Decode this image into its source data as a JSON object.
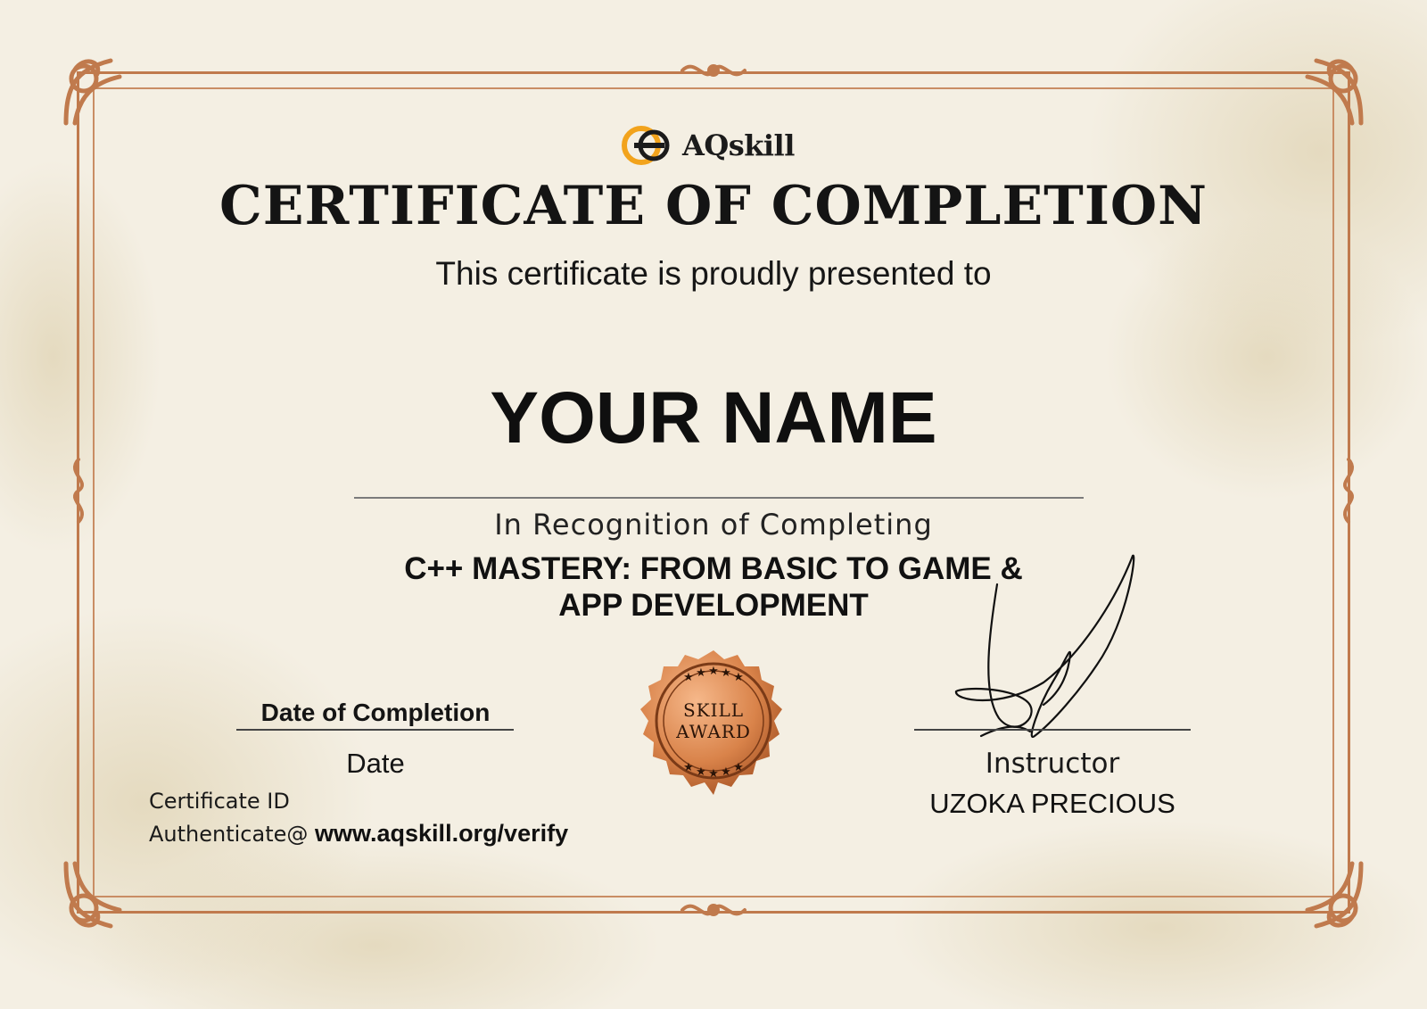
{
  "brand": {
    "name": "AQskill"
  },
  "certificate": {
    "title": "CERTIFICATE OF COMPLETION",
    "presented_text": "This certificate is proudly presented to",
    "recipient_name": "YOUR NAME",
    "recognition_text": "In Recognition of Completing",
    "course_line1": "C++ MASTERY: FROM BASIC TO GAME &",
    "course_line2": "APP DEVELOPMENT"
  },
  "seal": {
    "line1": "SKILL",
    "line2": "AWARD"
  },
  "completion": {
    "label": "Date of Completion",
    "value": "Date"
  },
  "verification": {
    "id_label": "Certificate ID",
    "auth_prefix": "Authenticate@ ",
    "url": "www.aqskill.org/verify"
  },
  "instructor": {
    "label": "Instructor",
    "name": "UZOKA PRECIOUS"
  },
  "colors": {
    "border": "#c07a4d",
    "background": "#f4efe3",
    "logo_accent": "#f2a31c",
    "seal": "#d9834a"
  }
}
